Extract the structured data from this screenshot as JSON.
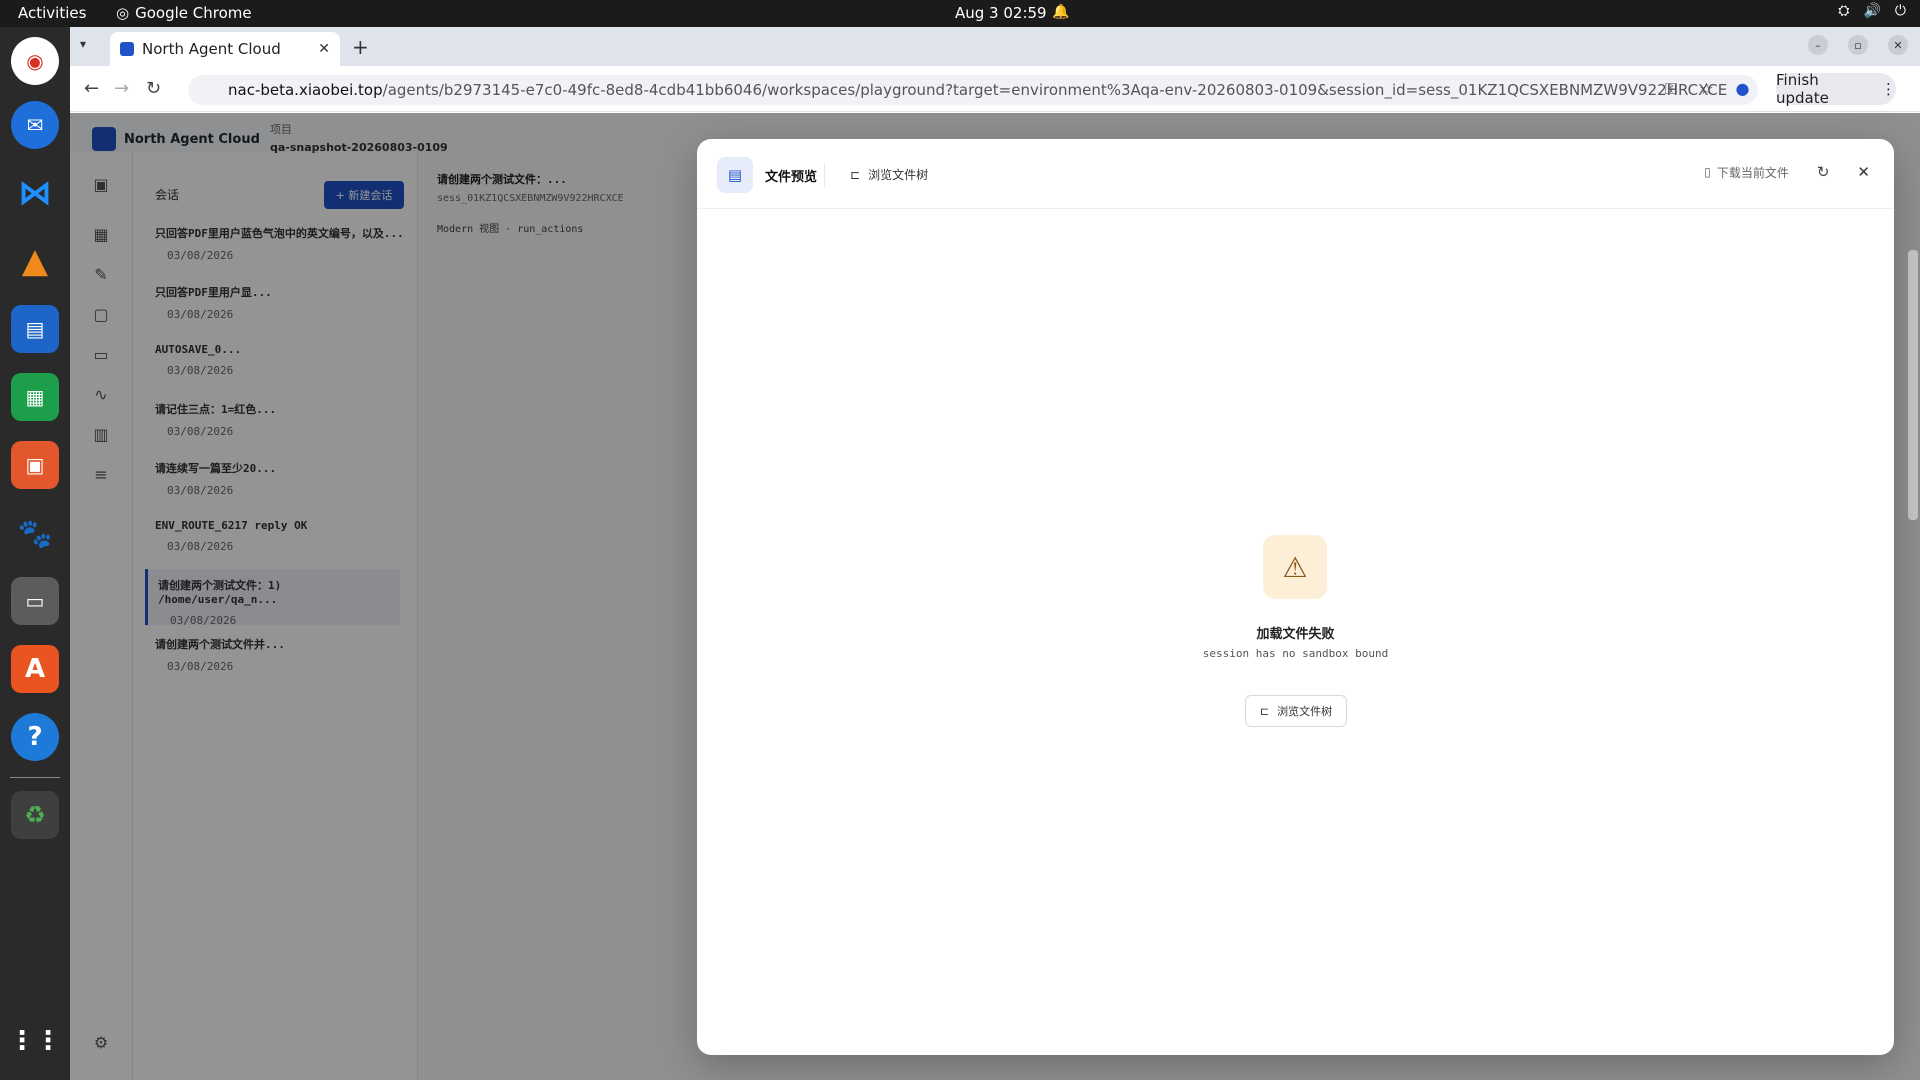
{
  "system_bar": {
    "activities": "Activities",
    "app_name": "Google Chrome",
    "clock": "Aug 3  02:59"
  },
  "dock": {
    "apps": [
      "chrome-icon",
      "thunderbird-icon",
      "vscode-icon",
      "vlc-icon",
      "writer-icon",
      "calc-icon",
      "impress-icon",
      "gimp-icon",
      "files-icon",
      "appcenter-icon",
      "help-icon",
      "trash-icon",
      "app-grid-icon"
    ]
  },
  "browser": {
    "tab_title": "North Agent Cloud",
    "url_host": "nac-beta.xiaobei.top",
    "url_path": "/agents/b2973145-e7c0-49fc-8ed8-4cdb41bb6046/workspaces/playground?target=environment%3Aqa-env-20260803-0109&session_id=sess_01KZ1QCSXEBNMZW9V922HRCXCE",
    "finish_update": "Finish update"
  },
  "app": {
    "brand": "North Agent Cloud",
    "project_label": "项目",
    "project_name": "qa-snapshot-20260803-0109",
    "sessions_heading": "会话",
    "new_session": "+ 新建会话",
    "sessions": [
      {
        "title": "只回答PDF里用户蓝色气泡中的英文编号，以及...",
        "date": "03/08/2026"
      },
      {
        "title": "只回答PDF里用户显...",
        "date": "03/08/2026"
      },
      {
        "title": "AUTOSAVE_0...",
        "date": "03/08/2026"
      },
      {
        "title": "请记住三点：1=红色...",
        "date": "03/08/2026"
      },
      {
        "title": "请连续写一篇至少20...",
        "date": "03/08/2026"
      },
      {
        "title": "ENV_ROUTE_6217 reply OK",
        "date": "03/08/2026"
      },
      {
        "title": "请创建两个测试文件：1) /home/user/qa_n...",
        "date": "03/08/2026"
      },
      {
        "title": "请创建两个测试文件并...",
        "date": "03/08/2026"
      }
    ],
    "conversation_title": "请创建两个测试文件：...",
    "conversation_id": "sess_01KZ1QCSXEBNMZW9V922HRCXCE",
    "conversation_mode": "Modern 视图 · run_actions"
  },
  "modal": {
    "tab_preview": "文件预览",
    "tab_tree": "浏览文件树",
    "download": "下载当前文件",
    "error_title": "加载文件失败",
    "error_message": "session has no sandbox bound",
    "browse_button": "浏览文件树"
  }
}
